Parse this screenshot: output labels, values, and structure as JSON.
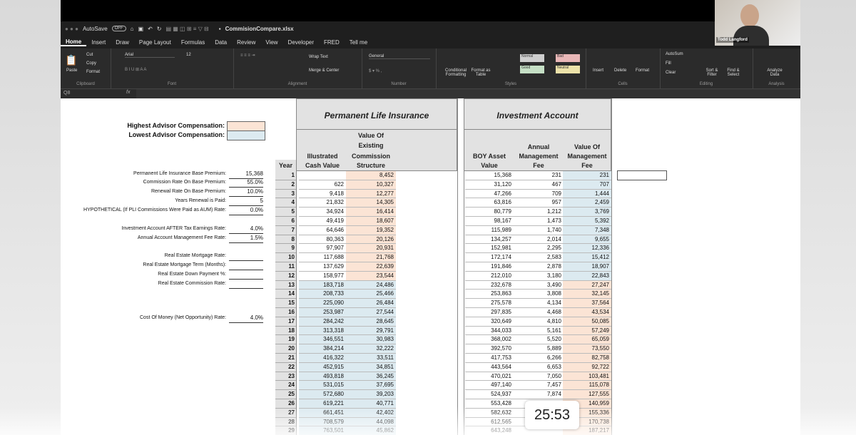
{
  "window": {
    "title": "CommisionCompare.xlsx",
    "autosave": "AutoSave",
    "autosave_state": "OFF"
  },
  "tabs": [
    "Home",
    "Insert",
    "Draw",
    "Page Layout",
    "Formulas",
    "Data",
    "Review",
    "View",
    "Developer",
    "FRED",
    "Tell me"
  ],
  "ribbon": {
    "clipboard": {
      "label": "Clipboard",
      "paste": "Paste",
      "cut": "Cut",
      "copy": "Copy",
      "format": "Format"
    },
    "font": {
      "label": "Font",
      "name": "Arial",
      "size": "12"
    },
    "alignment": {
      "label": "Alignment",
      "wrap": "Wrap Text",
      "merge": "Merge & Center"
    },
    "number": {
      "label": "Number",
      "format": "General"
    },
    "styles": {
      "label": "Styles",
      "cond": "Conditional Formatting",
      "table": "Format as Table",
      "normal": "Normal",
      "bad": "Bad",
      "good": "Good",
      "neutral": "Neutral"
    },
    "cells": {
      "label": "Cells",
      "insert": "Insert",
      "delete": "Delete",
      "format": "Format"
    },
    "editing": {
      "label": "Editing",
      "autosum": "AutoSum",
      "fill": "Fill",
      "clear": "Clear",
      "sort": "Sort & Filter",
      "find": "Find & Select"
    },
    "analysis": {
      "label": "Analysis",
      "analyze": "Analyze Data"
    }
  },
  "formula_bar": {
    "name_box": "Q8",
    "fx": "fx"
  },
  "video": {
    "name": "Todd Langford"
  },
  "legend": {
    "highest": "Highest Advisor Compensation:",
    "lowest": "Lowest Advisor Compensation:"
  },
  "inputs": [
    {
      "label": "Permanent Life Insurance Base Premium:",
      "value": "15,368"
    },
    {
      "label": "Commission Rate On Base Premium:",
      "value": "55.0%"
    },
    {
      "label": "Renewal Rate On Base Premium:",
      "value": "10.0%"
    },
    {
      "label": "Years Renewal is Paid:",
      "value": "5"
    },
    {
      "label": "HYPOTHETICAL (If PLI Commissions Were Paid as AUM) Rate:",
      "value": "0.0%"
    },
    {
      "label": "Investment Account AFTER Tax Earnings Rate:",
      "value": "4.0%"
    },
    {
      "label": "Annual Account Management Fee Rate:",
      "value": "1.5%"
    },
    {
      "label": "Real Estate Mortgage Rate:",
      "value": ""
    },
    {
      "label": "Real Estate Mortgage Term (Months):",
      "value": ""
    },
    {
      "label": "Real Estate Down Payment %:",
      "value": ""
    },
    {
      "label": "Real Estate Commission Rate:",
      "value": ""
    },
    {
      "label": "Cost Of Money (Net Opportunity) Rate:",
      "value": "4.0%"
    }
  ],
  "section_titles": {
    "pli": "Permanent Life Insurance",
    "inv": "Investment Account"
  },
  "columns": {
    "year": "Year",
    "cash": [
      "Illustrated",
      "Cash Value"
    ],
    "comm": [
      "Value Of",
      "Existing",
      "Commission",
      "Structure"
    ],
    "boy": [
      "BOY Asset",
      "Value"
    ],
    "fee": [
      "Annual",
      "Management",
      "Fee"
    ],
    "mgmt": [
      "Value Of",
      "Management",
      "Fee"
    ]
  },
  "rows": [
    [
      "1",
      "",
      "8,452",
      "15,368",
      "231",
      "231"
    ],
    [
      "2",
      "622",
      "10,327",
      "31,120",
      "467",
      "707"
    ],
    [
      "3",
      "9,418",
      "12,277",
      "47,266",
      "709",
      "1,444"
    ],
    [
      "4",
      "21,832",
      "14,305",
      "63,816",
      "957",
      "2,459"
    ],
    [
      "5",
      "34,924",
      "16,414",
      "80,779",
      "1,212",
      "3,769"
    ],
    [
      "6",
      "49,419",
      "18,607",
      "98,167",
      "1,473",
      "5,392"
    ],
    [
      "7",
      "64,646",
      "19,352",
      "115,989",
      "1,740",
      "7,348"
    ],
    [
      "8",
      "80,363",
      "20,126",
      "134,257",
      "2,014",
      "9,655"
    ],
    [
      "9",
      "97,907",
      "20,931",
      "152,981",
      "2,295",
      "12,336"
    ],
    [
      "10",
      "117,688",
      "21,768",
      "172,174",
      "2,583",
      "15,412"
    ],
    [
      "11",
      "137,629",
      "22,639",
      "191,846",
      "2,878",
      "18,907"
    ],
    [
      "12",
      "158,977",
      "23,544",
      "212,010",
      "3,180",
      "22,843"
    ],
    [
      "13",
      "183,718",
      "24,486",
      "232,678",
      "3,490",
      "27,247"
    ],
    [
      "14",
      "208,733",
      "25,466",
      "253,863",
      "3,808",
      "32,145"
    ],
    [
      "15",
      "225,090",
      "26,484",
      "275,578",
      "4,134",
      "37,564"
    ],
    [
      "16",
      "253,987",
      "27,544",
      "297,835",
      "4,468",
      "43,534"
    ],
    [
      "17",
      "284,242",
      "28,645",
      "320,649",
      "4,810",
      "50,085"
    ],
    [
      "18",
      "313,318",
      "29,791",
      "344,033",
      "5,161",
      "57,249"
    ],
    [
      "19",
      "346,551",
      "30,983",
      "368,002",
      "5,520",
      "65,059"
    ],
    [
      "20",
      "384,214",
      "32,222",
      "392,570",
      "5,889",
      "73,550"
    ],
    [
      "21",
      "416,322",
      "33,511",
      "417,753",
      "6,266",
      "82,758"
    ],
    [
      "22",
      "452,915",
      "34,851",
      "443,564",
      "6,653",
      "92,722"
    ],
    [
      "23",
      "493,818",
      "36,245",
      "470,021",
      "7,050",
      "103,481"
    ],
    [
      "24",
      "531,015",
      "37,695",
      "497,140",
      "7,457",
      "115,078"
    ],
    [
      "25",
      "572,680",
      "39,203",
      "524,937",
      "7,874",
      "127,555"
    ],
    [
      "26",
      "619,221",
      "40,771",
      "553,428",
      "8,301",
      "140,959"
    ],
    [
      "27",
      "661,451",
      "42,402",
      "582,632",
      "",
      "155,336"
    ],
    [
      "28",
      "708,579",
      "44,098",
      "612,565",
      "",
      "170,738"
    ],
    [
      "29",
      "763,501",
      "45,862",
      "643,248",
      "",
      "187,217"
    ]
  ],
  "timer": "25:53",
  "colors": {
    "pink": "#fbe4d5",
    "blue": "#dceaf0",
    "header_gray": "#e2e2e2"
  }
}
